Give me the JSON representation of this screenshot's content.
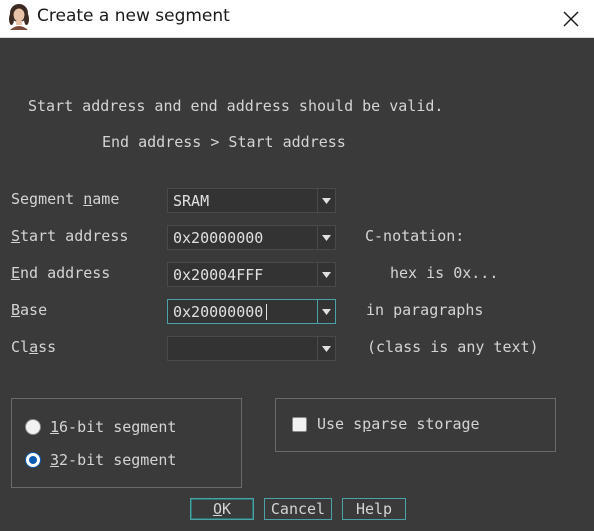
{
  "window": {
    "title": "Create a new segment",
    "icon": "app-portrait-icon",
    "close_icon": "close-icon"
  },
  "message": {
    "line1": "Start address and end address should be valid.",
    "line2": "End address > Start address"
  },
  "fields": {
    "segment_name": {
      "label_pre": "Segment ",
      "label_ul": "n",
      "label_post": "ame",
      "value": "SRAM"
    },
    "start_address": {
      "label_pre": "",
      "label_ul": "S",
      "label_post": "tart address",
      "value": "0x20000000",
      "note": "C-notation:"
    },
    "end_address": {
      "label_pre": "",
      "label_ul": "E",
      "label_post": "nd address",
      "value": "0x20004FFF",
      "note": "hex is 0x..."
    },
    "base": {
      "label_pre": "",
      "label_ul": "B",
      "label_post": "ase",
      "value": "0x20000000",
      "note": "in paragraphs"
    },
    "class": {
      "label_pre": "Cl",
      "label_ul": "a",
      "label_post": "ss",
      "value": "",
      "note": "(class is any text)"
    }
  },
  "bitness": {
    "options": [
      {
        "label_ul": "1",
        "label_rest": "6-bit segment",
        "selected": false
      },
      {
        "label_ul": "3",
        "label_rest": "2-bit segment",
        "selected": true
      }
    ]
  },
  "sparse": {
    "label_pre": "Use s",
    "label_ul": "p",
    "label_post": "arse storage",
    "checked": false
  },
  "buttons": {
    "ok": {
      "label_ul": "O",
      "label_rest": "K"
    },
    "cancel": "Cancel",
    "help": "Help"
  },
  "colors": {
    "background": "#3a3a3a",
    "accent": "#4aa3a6",
    "radio_selected": "#0a5bb5"
  }
}
